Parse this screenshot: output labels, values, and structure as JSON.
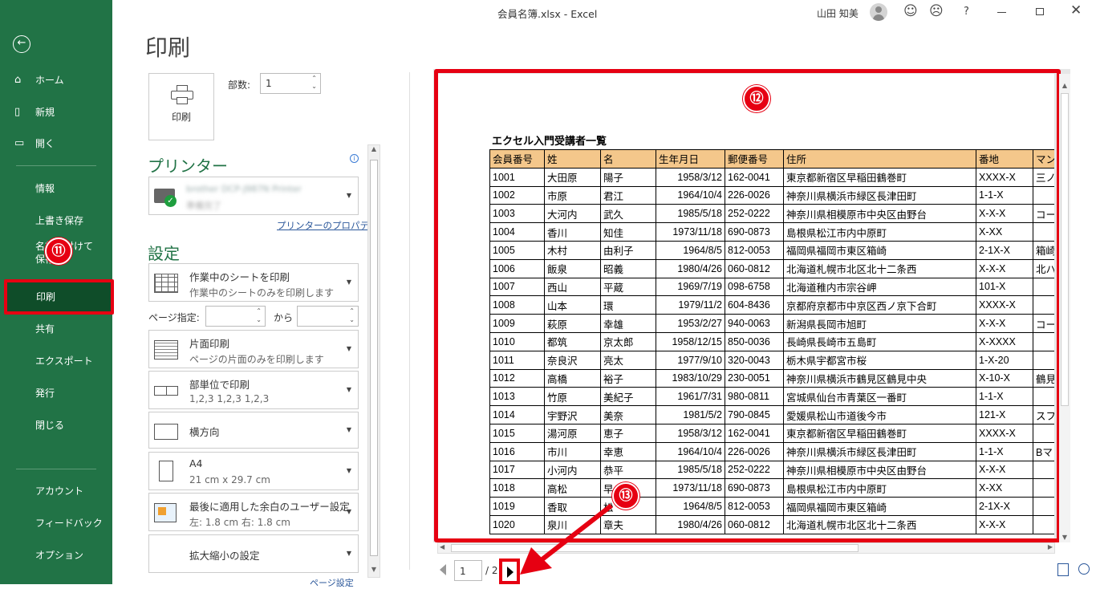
{
  "title_bar": {
    "title": "会員名簿.xlsx  -  Excel",
    "user": "山田 知美",
    "help": "?"
  },
  "sidebar": {
    "back_label": "←",
    "items": [
      "ホーム",
      "新規",
      "開く",
      "情報",
      "上書き保存",
      "名前を付けて保存",
      "印刷",
      "共有",
      "エクスポート",
      "発行",
      "閉じる"
    ],
    "bottom_items": [
      "アカウント",
      "フィードバック",
      "オプション"
    ]
  },
  "print": {
    "heading": "印刷",
    "print_button": "印刷",
    "copies_label": "部数:",
    "copies_value": "1",
    "printer_heading": "プリンター",
    "printer_name": "brother DCP-J987N Printer",
    "printer_status": "準備完了",
    "printer_props": "プリンターのプロパティ",
    "settings_heading": "設定",
    "page_label": "ページ指定:",
    "page_to": "から",
    "options": [
      {
        "t1": "作業中のシートを印刷",
        "t2": "作業中のシートのみを印刷します"
      },
      {
        "t1": "片面印刷",
        "t2": "ページの片面のみを印刷します"
      },
      {
        "t1": "部単位で印刷",
        "t2": "1,2,3    1,2,3    1,2,3"
      },
      {
        "t1": "横方向",
        "t2": ""
      },
      {
        "t1": "A4",
        "t2": "21 cm x 29.7 cm"
      },
      {
        "t1": "最後に適用した余白のユーザー設定",
        "t2": "左:  1.8 cm     右:  1.8 cm"
      },
      {
        "t1": "拡大縮小の設定",
        "t2": ""
      }
    ],
    "page_setup": "ページ設定"
  },
  "preview": {
    "sheet_title": "エクセル入門受講者一覧",
    "headers": [
      "会員番号",
      "姓",
      "名",
      "生年月日",
      "郵便番号",
      "住所",
      "番地",
      "マン"
    ],
    "rows": [
      [
        "1001",
        "大田原",
        "陽子",
        "1958/3/12",
        "162-0041",
        "東京都新宿区早稲田鶴巻町",
        "XXXX-X",
        "三ノ"
      ],
      [
        "1002",
        "市原",
        "君江",
        "1964/10/4",
        "226-0026",
        "神奈川県横浜市緑区長津田町",
        "1-1-X",
        ""
      ],
      [
        "1003",
        "大河内",
        "武久",
        "1985/5/18",
        "252-0222",
        "神奈川県相模原市中央区由野台",
        "X-X-X",
        "コー"
      ],
      [
        "1004",
        "香川",
        "知佳",
        "1973/11/18",
        "690-0873",
        "島根県松江市内中原町",
        "X-XX",
        ""
      ],
      [
        "1005",
        "木村",
        "由利子",
        "1964/8/5",
        "812-0053",
        "福岡県福岡市東区箱崎",
        "2-1X-X",
        "箱崎"
      ],
      [
        "1006",
        "飯泉",
        "昭義",
        "1980/4/26",
        "060-0812",
        "北海道札幌市北区北十二条西",
        "X-X-X",
        "北ハ"
      ],
      [
        "1007",
        "西山",
        "平蔵",
        "1969/7/19",
        "098-6758",
        "北海道稚内市宗谷岬",
        "101-X",
        ""
      ],
      [
        "1008",
        "山本",
        "環",
        "1979/11/2",
        "604-8436",
        "京都府京都市中京区西ノ京下合町",
        "XXXX-X",
        ""
      ],
      [
        "1009",
        "萩原",
        "幸雄",
        "1953/2/27",
        "940-0063",
        "新潟県長岡市旭町",
        "X-X-X",
        "コー"
      ],
      [
        "1010",
        "都筑",
        "京太郎",
        "1958/12/15",
        "850-0036",
        "長崎県長崎市五島町",
        "X-XXXX",
        ""
      ],
      [
        "1011",
        "奈良沢",
        "亮太",
        "1977/9/10",
        "320-0043",
        "栃木県宇都宮市桜",
        "1-X-20",
        ""
      ],
      [
        "1012",
        "高橋",
        "裕子",
        "1983/10/29",
        "230-0051",
        "神奈川県横浜市鶴見区鶴見中央",
        "X-10-X",
        "鶴見"
      ],
      [
        "1013",
        "竹原",
        "美紀子",
        "1961/7/31",
        "980-0811",
        "宮城県仙台市青葉区一番町",
        "1-1-X",
        ""
      ],
      [
        "1014",
        "宇野沢",
        "美奈",
        "1981/5/2",
        "790-0845",
        "愛媛県松山市道後今市",
        "121-X",
        "スフ"
      ],
      [
        "1015",
        "湯河原",
        "恵子",
        "1958/3/12",
        "162-0041",
        "東京都新宿区早稲田鶴巻町",
        "XXXX-X",
        ""
      ],
      [
        "1016",
        "市川",
        "幸恵",
        "1964/10/4",
        "226-0026",
        "神奈川県横浜市緑区長津田町",
        "1-1-X",
        "Bマ"
      ],
      [
        "1017",
        "小河内",
        "恭平",
        "1985/5/18",
        "252-0222",
        "神奈川県相模原市中央区由野台",
        "X-X-X",
        ""
      ],
      [
        "1018",
        "高松",
        "早",
        "1973/11/18",
        "690-0873",
        "島根県松江市内中原町",
        "X-XX",
        ""
      ],
      [
        "1019",
        "香取",
        "松",
        "1964/8/5",
        "812-0053",
        "福岡県福岡市東区箱崎",
        "2-1X-X",
        ""
      ],
      [
        "1020",
        "泉川",
        "章夫",
        "1980/4/26",
        "060-0812",
        "北海道札幌市北区北十二条西",
        "X-X-X",
        ""
      ]
    ],
    "page_current": "1",
    "page_total": "/ 2"
  },
  "annotations": {
    "a11": "⑪",
    "a12": "⑫",
    "a13": "⑬"
  },
  "colors": {
    "excel_green": "#217346",
    "selected": "#0f4d29",
    "highlight_red": "#e60012",
    "header_fill": "#f4c78b"
  }
}
